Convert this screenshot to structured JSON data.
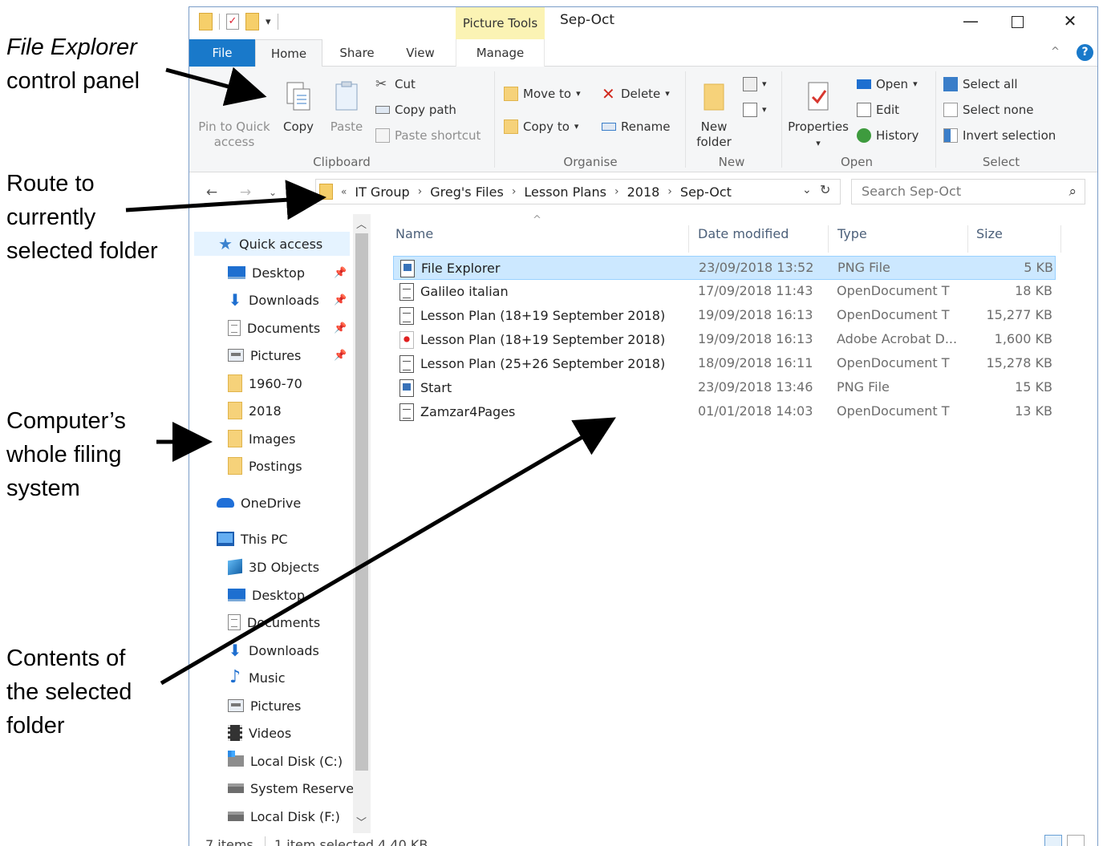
{
  "annotations": [
    {
      "line1": "File Explorer",
      "line2": "control panel",
      "line3": ""
    },
    {
      "line1": "Route to",
      "line2": "currently",
      "line3": "selected folder"
    },
    {
      "line1": "Computer’s",
      "line2": "whole filing",
      "line3": "system"
    },
    {
      "line1": "Contents of",
      "line2": "the selected",
      "line3": "folder"
    }
  ],
  "window": {
    "title": "Sep-Oct",
    "context_tab": "Picture Tools",
    "controls": {
      "minimize": "—",
      "maximize": "",
      "close": "✕"
    }
  },
  "tabs": {
    "file": "File",
    "home": "Home",
    "share": "Share",
    "view": "View",
    "manage": "Manage",
    "collapse": "^",
    "help": "?"
  },
  "ribbon": {
    "clipboard": {
      "label": "Clipboard",
      "pin": "Pin to Quick\naccess",
      "pin_l1": "Pin to Quick",
      "pin_l2": "access",
      "copy": "Copy",
      "paste": "Paste",
      "cut": "Cut",
      "copy_path": "Copy path",
      "paste_shortcut": "Paste shortcut"
    },
    "organise": {
      "label": "Organise",
      "move_to": "Move to",
      "copy_to": "Copy to",
      "delete": "Delete",
      "rename": "Rename"
    },
    "new": {
      "label": "New",
      "new_folder_l1": "New",
      "new_folder_l2": "folder"
    },
    "open": {
      "label": "Open",
      "properties": "Properties",
      "open": "Open",
      "edit": "Edit",
      "history": "History"
    },
    "select": {
      "label": "Select",
      "select_all": "Select all",
      "select_none": "Select none",
      "invert": "Invert selection"
    }
  },
  "address": {
    "overflow": "«",
    "crumbs": [
      "IT Group",
      "Greg's Files",
      "Lesson Plans",
      "2018",
      "Sep-Oct"
    ],
    "search_placeholder": "Search Sep-Oct"
  },
  "nav": {
    "quick_access": "Quick access",
    "quick_items": [
      "Desktop",
      "Downloads",
      "Documents",
      "Pictures",
      "1960-70",
      "2018",
      "Images",
      "Postings"
    ],
    "onedrive": "OneDrive",
    "this_pc": "This PC",
    "pc_items": [
      "3D Objects",
      "Desktop",
      "Documents",
      "Downloads",
      "Music",
      "Pictures",
      "Videos",
      "Local Disk (C:)",
      "System Reservec",
      "Local Disk (F:)"
    ]
  },
  "columns": {
    "name": "Name",
    "date": "Date modified",
    "type": "Type",
    "size": "Size"
  },
  "files": [
    {
      "name": "File Explorer",
      "date": "23/09/2018 13:52",
      "type": "PNG File",
      "size": "5 KB",
      "icon": "png-file-icon",
      "selected": true
    },
    {
      "name": "Galileo italian",
      "date": "17/09/2018 11:43",
      "type": "OpenDocument T",
      "size": "18 KB",
      "icon": "odt-file-icon",
      "selected": false
    },
    {
      "name": "Lesson Plan (18+19 September 2018)",
      "date": "19/09/2018 16:13",
      "type": "OpenDocument T",
      "size": "15,277 KB",
      "icon": "odt-file-icon",
      "selected": false
    },
    {
      "name": "Lesson Plan (18+19 September 2018)",
      "date": "19/09/2018 16:13",
      "type": "Adobe Acrobat D...",
      "size": "1,600 KB",
      "icon": "pdf-file-icon",
      "selected": false
    },
    {
      "name": "Lesson Plan (25+26 September 2018)",
      "date": "18/09/2018 16:11",
      "type": "OpenDocument T",
      "size": "15,278 KB",
      "icon": "odt-file-icon",
      "selected": false
    },
    {
      "name": "Start",
      "date": "23/09/2018 13:46",
      "type": "PNG File",
      "size": "15 KB",
      "icon": "png-file-icon",
      "selected": false
    },
    {
      "name": "Zamzar4Pages",
      "date": "01/01/2018 14:03",
      "type": "OpenDocument T",
      "size": "13 KB",
      "icon": "odt-file-icon",
      "selected": false
    }
  ],
  "status": {
    "count": "7 items",
    "selected": "1 item selected  4.40 KB"
  }
}
